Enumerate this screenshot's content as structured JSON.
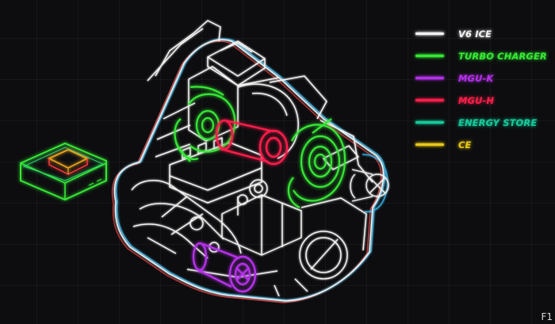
{
  "legend": {
    "items": [
      {
        "key": "v6-ice",
        "label": "V6 ICE",
        "color": "#f2f2f2"
      },
      {
        "key": "turbo-charger",
        "label": "TURBO CHARGER",
        "color": "#34e834"
      },
      {
        "key": "mgu-k",
        "label": "MGU-K",
        "color": "#b430e8"
      },
      {
        "key": "mgu-h",
        "label": "MGU-H",
        "color": "#ff1f4b"
      },
      {
        "key": "energy-store",
        "label": "ENERGY STORE",
        "color": "#16c99a"
      },
      {
        "key": "ce",
        "label": "CE",
        "color": "#e8c81a"
      }
    ]
  },
  "corner_tag": "F1",
  "outline_colors": {
    "cyan_glow": "#38c6ff",
    "red_offset": "#ff3b3b"
  }
}
